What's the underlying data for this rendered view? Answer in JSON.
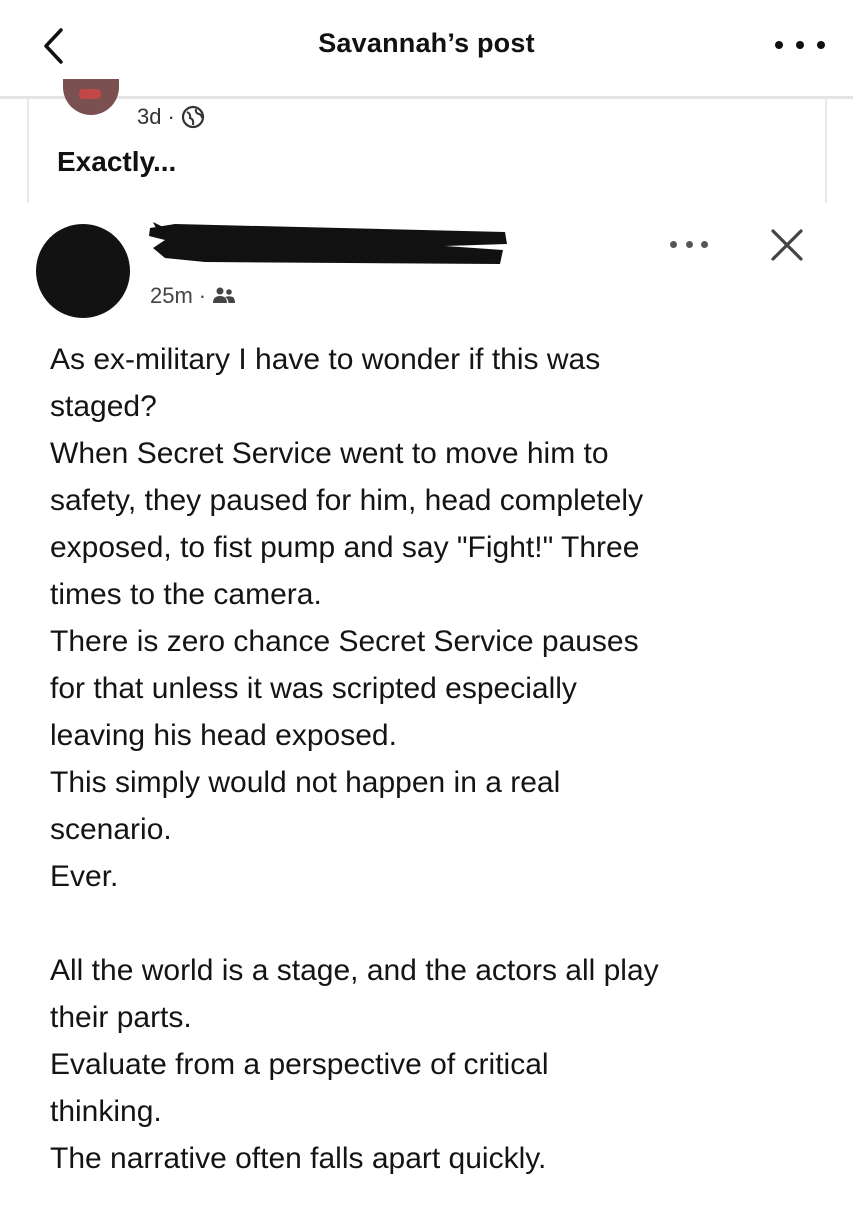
{
  "header": {
    "title": "Savannah’s post",
    "back_icon": "chevron-left-icon",
    "more_icon": "more-horizontal-icon"
  },
  "shared_post": {
    "time": "3d",
    "separator": "·",
    "audience_icon": "globe-icon",
    "text": "Exactly..."
  },
  "comment": {
    "author_redacted": true,
    "time": "25m",
    "separator": "·",
    "audience_icon": "friends-icon",
    "more_icon": "more-horizontal-icon",
    "close_icon": "close-icon",
    "lines": [
      "As ex-military I have to wonder if this was",
      "staged?",
      "When Secret Service went to move him to",
      "safety, they paused for him, head completely",
      "exposed, to fist pump and say \"Fight!\" Three",
      "times to the camera.",
      "There is zero chance Secret Service pauses",
      "for that unless it was scripted especially",
      "leaving his head exposed.",
      "This simply would not happen in a real",
      "scenario.",
      "Ever.",
      "",
      "All the world is a stage, and the actors all play",
      "their parts.",
      "Evaluate from a perspective of critical",
      "thinking.",
      "The narrative often falls apart quickly."
    ]
  },
  "colors": {
    "text": "#141414",
    "divider": "#e4e4e4",
    "avatar": "#121212",
    "redaction": "#111111"
  }
}
